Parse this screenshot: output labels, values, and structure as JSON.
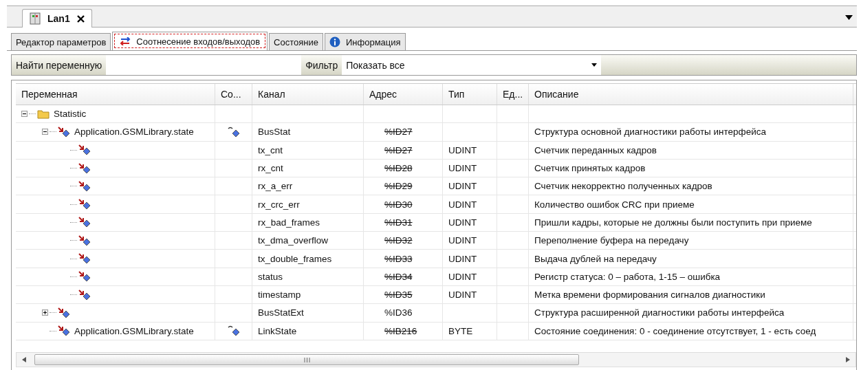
{
  "document_tab": {
    "title": "Lan1"
  },
  "tabs": [
    {
      "label": "Редактор параметров",
      "selected": false,
      "kind": "plain"
    },
    {
      "label": "Соотнесение входов/выходов",
      "selected": true,
      "kind": "mapping"
    },
    {
      "label": "Состояние",
      "selected": false,
      "kind": "plain"
    },
    {
      "label": "Информация",
      "selected": false,
      "kind": "info"
    }
  ],
  "filter_bar": {
    "search_label": "Найти переменную",
    "filter_label": "Фильтр",
    "filter_value": "Показать все"
  },
  "table": {
    "columns": [
      "Переменная",
      "Со...",
      "Канал",
      "Адрес",
      "Тип",
      "Ед...",
      "Описание"
    ],
    "rows": [
      {
        "kind": "folder",
        "variable": "Statistic",
        "expanded": true,
        "children": [
          {
            "kind": "variable",
            "variable": "Application.GSMLibrary.state",
            "mapped": true,
            "channel": "BusStat",
            "address": "%ID27",
            "struck": true,
            "description": "Структура основной диагностики работы интерфейса",
            "expanded": true,
            "children": [
              {
                "kind": "variable",
                "mapped": false,
                "channel": "tx_cnt",
                "address": "%ID27",
                "struck": true,
                "type": "UDINT",
                "description": "Счетчик переданных кадров"
              },
              {
                "kind": "variable",
                "mapped": false,
                "channel": "rx_cnt",
                "address": "%ID28",
                "struck": true,
                "type": "UDINT",
                "description": "Счетчик принятых кадров"
              },
              {
                "kind": "variable",
                "mapped": false,
                "channel": "rx_a_err",
                "address": "%ID29",
                "struck": true,
                "type": "UDINT",
                "description": "Счетчик некорректно полученных кадров"
              },
              {
                "kind": "variable",
                "mapped": false,
                "channel": "rx_crc_err",
                "address": "%ID30",
                "struck": true,
                "type": "UDINT",
                "description": "Количество ошибок CRC  при приеме"
              },
              {
                "kind": "variable",
                "mapped": false,
                "channel": "rx_bad_frames",
                "address": "%ID31",
                "struck": true,
                "type": "UDINT",
                "description": "Пришли кадры, которые не должны были поступить при приеме"
              },
              {
                "kind": "variable",
                "mapped": false,
                "channel": "tx_dma_overflow",
                "address": "%ID32",
                "struck": true,
                "type": "UDINT",
                "description": "Переполнение буфера на передачу"
              },
              {
                "kind": "variable",
                "mapped": false,
                "channel": "tx_double_frames",
                "address": "%ID33",
                "struck": true,
                "type": "UDINT",
                "description": "Выдача дублей на передачу"
              },
              {
                "kind": "variable",
                "mapped": false,
                "channel": "status",
                "address": "%ID34",
                "struck": true,
                "type": "UDINT",
                "description": "Регистр статуса: 0 – работа, 1-15 – ошибка"
              },
              {
                "kind": "variable",
                "mapped": false,
                "channel": "timestamp",
                "address": "%ID35",
                "struck": true,
                "type": "UDINT",
                "description": "Метка времени формирования сигналов диагностики"
              }
            ]
          },
          {
            "kind": "variable",
            "mapped": false,
            "channel": "BusStatExt",
            "address": "%ID36",
            "struck": false,
            "description": "Структура расширенной диагностики работы интерфейса",
            "expanded": false
          },
          {
            "kind": "variable",
            "variable": "Application.GSMLibrary.state",
            "mapped": true,
            "channel": "LinkState",
            "address": "%IB216",
            "struck": true,
            "type": "BYTE",
            "description": "Состояние соединения: 0 - соединение отсутствует, 1 - есть соед"
          }
        ]
      }
    ]
  }
}
